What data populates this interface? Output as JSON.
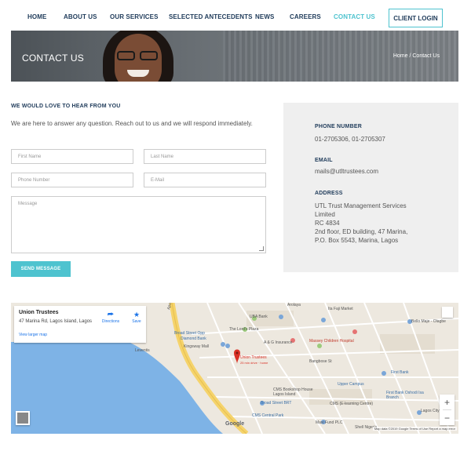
{
  "nav": {
    "items": [
      "HOME",
      "ABOUT US",
      "OUR SERVICES",
      "SELECTED ANTECEDENTS",
      "NEWS",
      "CAREERS",
      "CONTACT US"
    ],
    "active": "CONTACT US",
    "client_login": "CLIENT LOGIN"
  },
  "hero": {
    "title": "CONTACT US",
    "breadcrumb": "Home / Contact Us"
  },
  "form": {
    "heading": "WE WOULD LOVE TO HEAR FROM YOU",
    "intro": "We are here to answer any question. Reach out to us and we will respond immediately.",
    "first_name_placeholder": "First Name",
    "last_name_placeholder": "Last Name",
    "phone_placeholder": "Phone Number",
    "email_placeholder": "E-Mail",
    "message_placeholder": "Message",
    "send_label": "SEND MESSAGE"
  },
  "contact": {
    "phone_label": "PHONE NUMBER",
    "phone_value": "01-2705306, 01-2705307",
    "email_label": "EMAIL",
    "email_value": "mails@utltrustees.com",
    "address_label": "ADDRESS",
    "address_lines": [
      "UTL Trust Management Services",
      "Limited",
      "RC 4834",
      "2nd floor, ED building, 47 Marina,",
      "P.O. Box 5543, Marina, Lagos"
    ]
  },
  "map": {
    "place_name": "Union Trustees",
    "place_address": "47 Marina Rd, Lagos Island, Lagos",
    "directions_label": "Directions",
    "save_label": "Save",
    "larger_map_label": "View larger map",
    "pin_label": "Union Trustees",
    "pin_sublabel": "25 min drive · home",
    "labels": {
      "arolaya": "Arolaya",
      "ita_faji": "Ita Faji Market",
      "uba_bank": "UBA Bank",
      "bello_maje": "Bello Maje - Olagbe",
      "lords_plaza": "The Lord's Plaza",
      "broad_street": "Broad Street Opp",
      "diamond_bank": "Diamond Bank",
      "kingsway": "Kingsway Mall",
      "leventis": "Leventis",
      "ag_insurance": "A & G Insurance",
      "massey": "Massey Children Hospital",
      "first_bank": "First Bank",
      "upper_campus": "Upper Campus",
      "cms_bookshop": "CMS Bookshop House Lagos Island",
      "cms_elearning": "CMS (E-learning Centre)",
      "broad_brt": "Broad Street BRT",
      "cms_central": "CMS Central Park",
      "maxi_fund": "Maxi Fund PLC",
      "lagos_city_hall": "Lagos City Hall",
      "first_bank_oshodi": "First Bank Oshodi Isa Branch",
      "shell_nigeria": "Shell Nigeria",
      "bangbose": "Bangbose St",
      "apongbon": "Apongbon St"
    },
    "google": "Google",
    "footer": "Map data ©2019 Google   Terms of Use   Report a map error"
  },
  "colors": {
    "accent": "#4ec3cf",
    "navy": "#1f3b5a",
    "panel": "#efefef",
    "water": "#7eb3e6",
    "road_major": "#f5d36b",
    "pin": "#d93025"
  }
}
